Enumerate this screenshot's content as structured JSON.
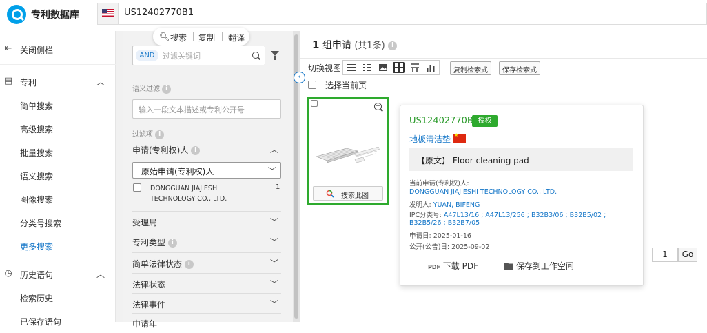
{
  "app": {
    "title": "专利数据库"
  },
  "search": {
    "value": "US12402770B1"
  },
  "sidebar": {
    "close_label": "关闭侧栏",
    "patent_section": "专利",
    "items": [
      "简单搜索",
      "高级搜索",
      "批量搜索",
      "语义搜索",
      "图像搜索",
      "分类号搜索",
      "更多搜索"
    ],
    "history_section": "历史语句",
    "history_items": [
      "检索历史",
      "已保存语句"
    ]
  },
  "toolbar_popup": {
    "search": "搜索",
    "copy": "复制",
    "translate": "翻译"
  },
  "filter": {
    "and_label": "AND",
    "keyword_placeholder": "过滤关键词",
    "semantic_label": "语义过滤",
    "semantic_placeholder": "输入一段文本描述或专利公开号",
    "filter_items_label": "过滤项",
    "applicant_header": "申请(专利权)人",
    "applicant_select": "原始申请(专利权)人",
    "applicant_option": {
      "name_line1": "DONGGUAN JIAJIESHI",
      "name_line2": "TECHNOLOGY CO., LTD.",
      "count": "1"
    },
    "facets": [
      "受理局",
      "专利类型",
      "简单法律状态",
      "法律状态",
      "法律事件",
      "申请年"
    ]
  },
  "results": {
    "count_label": "1",
    "count_unit": "组申请",
    "count_detail": "(共1条)",
    "view_label": "切换视图",
    "copy_query": "复制检索式",
    "save_query": "保存检索式",
    "select_page": "选择当前页",
    "image_search": "搜索此图",
    "page_value": "1",
    "go": "Go"
  },
  "patent": {
    "number": "US12402770B1",
    "status": "授权",
    "title": "地板清洁垫",
    "original_prefix": "【原文】",
    "original_title": "Floor cleaning pad",
    "current_applicant_label": "当前申请(专利权)人:",
    "current_applicant": "DONGGUAN JIAJIESHI TECHNOLOGY CO., LTD.",
    "inventor_label": "发明人:",
    "inventor": "YUAN, BIFENG",
    "ipc_label": "IPC分类号:",
    "ipc_line1": "A47L13/16 ;  A47L13/256 ;  B32B3/06 ;  B32B5/02 ;",
    "ipc_line2": "B32B5/26 ;  B32B7/05",
    "app_date_label": "申请日:",
    "app_date": "2025-01-16",
    "pub_date_label": "公开(公告)日:",
    "pub_date": "2025-09-02",
    "download_pdf": "下载 PDF",
    "save_workspace": "保存到工作空间"
  },
  "colors": {
    "accent": "#1677c8",
    "grant_green": "#2eaa2e"
  }
}
